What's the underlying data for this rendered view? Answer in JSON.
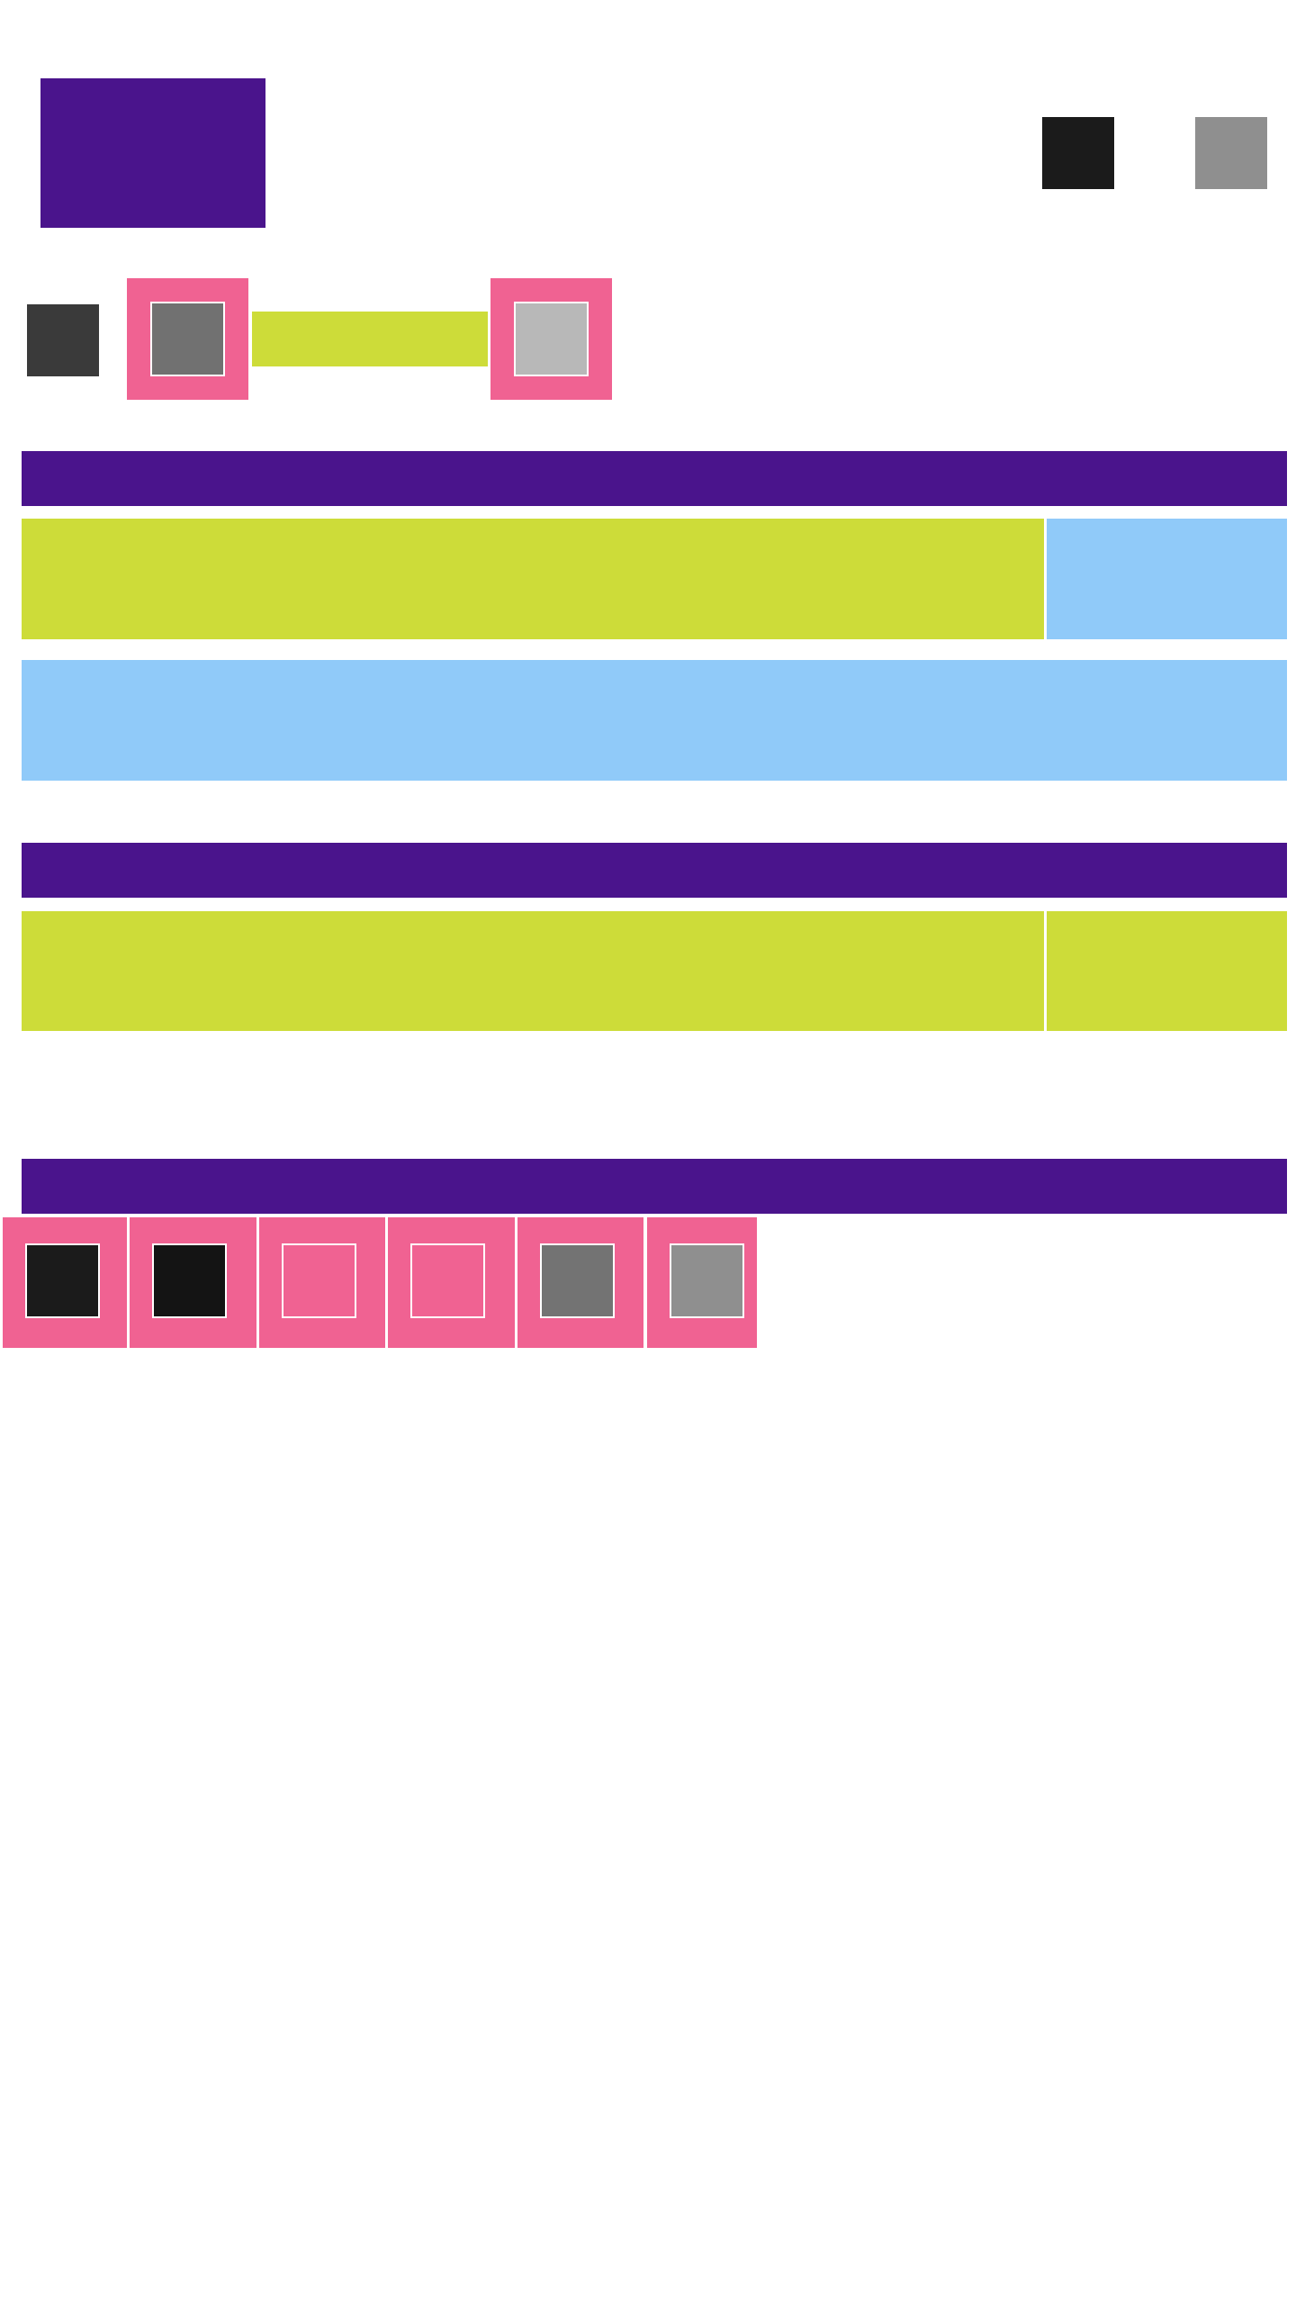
{
  "header": {
    "logo_icon": "logo-block",
    "actions": [
      {
        "icon": "dark-square-icon",
        "color": "#1b1b1b"
      },
      {
        "icon": "gray-square-icon",
        "color": "#8f8f8f"
      }
    ]
  },
  "toolbar": {
    "leading_icon": {
      "icon": "dark-square-icon",
      "color": "#3a3a3a"
    },
    "buttons": [
      {
        "icon": "gray-square-icon",
        "color": "#717171",
        "frame_color": "#f06292"
      },
      {
        "icon": "light-gray-square-icon",
        "color": "#b8b8b8",
        "frame_color": "#f06292"
      }
    ],
    "field_color": "#cddc39"
  },
  "colors": {
    "primary": "#4a148c",
    "accent_lime": "#cddc39",
    "accent_blue": "#90caf9",
    "accent_pink": "#f06292",
    "background": "#ffffff"
  },
  "swatches": [
    {
      "icon": "black-square-icon",
      "color": "#1b1b1b"
    },
    {
      "icon": "black-square-icon",
      "color": "#141414"
    },
    {
      "icon": "pink-square-icon",
      "color": "#f06292"
    },
    {
      "icon": "pink-square-icon",
      "color": "#f06292"
    },
    {
      "icon": "gray-square-icon",
      "color": "#737373"
    },
    {
      "icon": "gray-square-icon",
      "color": "#8f8f8f"
    }
  ]
}
